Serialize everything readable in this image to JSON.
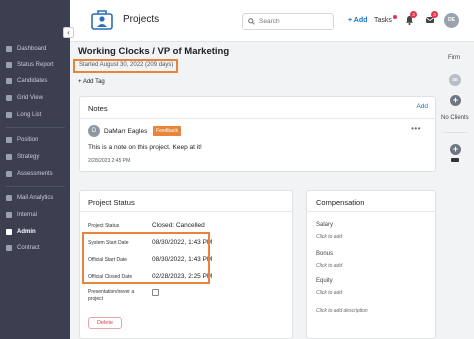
{
  "colors": {
    "sidebar_bg": "#3b3f50",
    "accent_blue": "#1a73c9",
    "highlight_orange": "#e8853a",
    "danger_red": "#d33a4a"
  },
  "header": {
    "title": "Projects",
    "search_placeholder": "Search",
    "add_label": "+ Add",
    "tasks_label": "Tasks",
    "notification_badge": "3",
    "messages_badge": "3",
    "user_initials": "DE"
  },
  "sidebar": {
    "collapse_icon": "chevron-left",
    "items": [
      {
        "label": "Dashboard",
        "icon": "dashboard-icon"
      },
      {
        "label": "Status Report",
        "icon": "report-icon"
      },
      {
        "label": "Candidates",
        "icon": "users-icon"
      },
      {
        "label": "Grid View",
        "icon": "grid-icon"
      },
      {
        "label": "Long List",
        "icon": "list-icon"
      },
      {
        "label": "Position",
        "icon": "position-icon"
      },
      {
        "label": "Strategy",
        "icon": "strategy-icon"
      },
      {
        "label": "Assessments",
        "icon": "assessment-icon"
      },
      {
        "label": "Mail Analytics",
        "icon": "mail-icon"
      },
      {
        "label": "Internal",
        "icon": "internal-icon"
      },
      {
        "label": "Admin",
        "icon": "admin-icon",
        "active": true
      },
      {
        "label": "Contract",
        "icon": "contract-icon"
      }
    ]
  },
  "project": {
    "title": "Working Clocks / VP of Marketing",
    "started": "Started August 30, 2022 (209 days)",
    "add_tag": "+ Add Tag"
  },
  "notes": {
    "title": "Notes",
    "add_label": "Add",
    "note": {
      "initials": "D",
      "author": "DaMarr Eagles",
      "tag": "Feedback",
      "menu": "•••",
      "text": "This is a note on this project. Keep at it!",
      "date": "2/28/2023 2:45 PM"
    }
  },
  "project_status": {
    "title": "Project Status",
    "rows": [
      {
        "label": "Project Status",
        "value": "Closed: Cancelled"
      },
      {
        "label": "System Start Date",
        "value": "08/30/2022, 1:43 PM"
      },
      {
        "label": "Official Start Date",
        "value": "08/30/2022, 1:43 PM"
      },
      {
        "label": "Official Closed Date",
        "value": "02/28/2023, 2:25 PM"
      }
    ],
    "presentation_label_1": "Presentation/never a",
    "presentation_label_2": "project",
    "presentation_checked": false,
    "delete_label": "Delete"
  },
  "compensation": {
    "title": "Compensation",
    "items": [
      {
        "label": "Salary",
        "action": "Click to add"
      },
      {
        "label": "Bonus",
        "action": "Click to add"
      },
      {
        "label": "Equity",
        "action": "Click to add"
      }
    ],
    "description_action": "Click to add description"
  },
  "right_rail": {
    "firm_label": "Firm",
    "se_initials": "SE",
    "no_clients_label": "No Clients"
  }
}
